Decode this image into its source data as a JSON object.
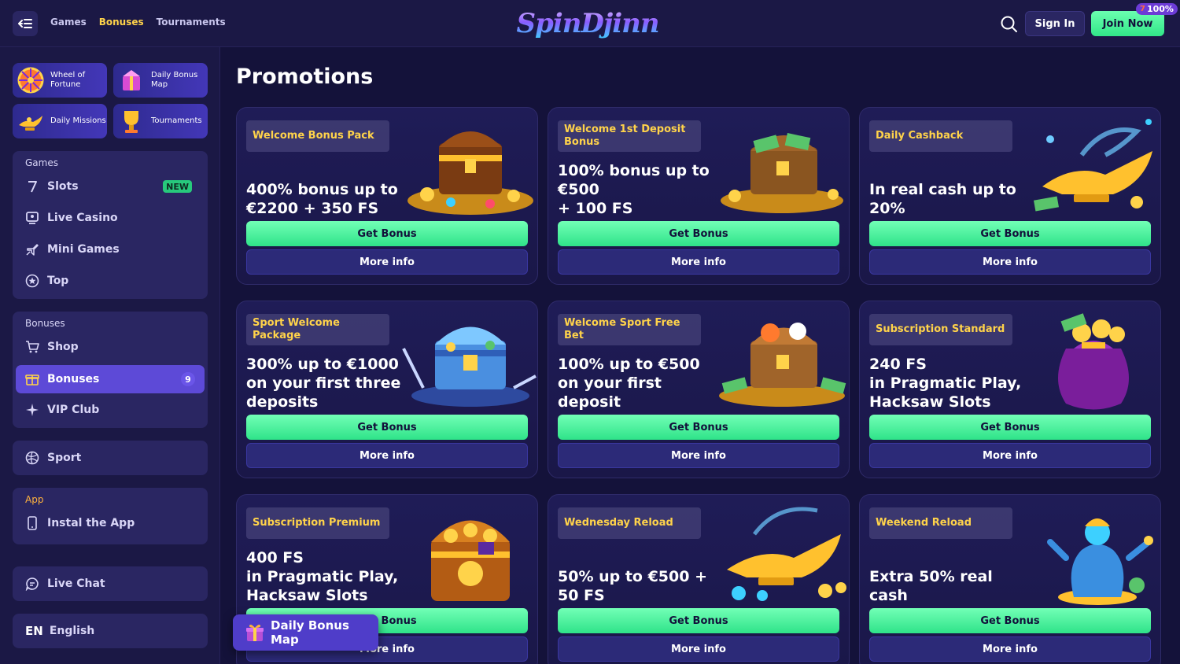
{
  "header": {
    "nav": [
      "Games",
      "Bonuses",
      "Tournaments"
    ],
    "active_nav": "Bonuses",
    "logo": "SpinDjinn",
    "sign_in": "Sign In",
    "join_now": "Join Now",
    "join_badge": "100%"
  },
  "sidebar": {
    "tiles": [
      {
        "label": "Wheel of\nFortune",
        "icon": "wheel-icon"
      },
      {
        "label": "Daily Bonus\nMap",
        "icon": "map-gift-icon"
      },
      {
        "label": "Daily Missions",
        "icon": "lamp-icon"
      },
      {
        "label": "Tournaments",
        "icon": "trophy-icon"
      }
    ],
    "games_title": "Games",
    "games_items": [
      {
        "label": "Slots",
        "badge": "NEW",
        "icon": "seven-icon"
      },
      {
        "label": "Live Casino",
        "icon": "live-icon"
      },
      {
        "label": "Mini Games",
        "icon": "plane-icon"
      },
      {
        "label": "Top",
        "icon": "star-icon"
      }
    ],
    "bonuses_title": "Bonuses",
    "bonuses_items": [
      {
        "label": "Shop",
        "icon": "cart-icon"
      },
      {
        "label": "Bonuses",
        "badge": "9",
        "icon": "gift-icon"
      },
      {
        "label": "VIP Club",
        "icon": "sparkle-icon"
      }
    ],
    "sport": "Sport",
    "app_title": "App",
    "install_app": "Instal the App",
    "live_chat": "Live Chat",
    "lang_code": "EN",
    "lang_name": "English"
  },
  "main": {
    "title": "Promotions",
    "get_bonus": "Get Bonus",
    "more_info": "More info",
    "cards": [
      {
        "label": "Welcome Bonus Pack",
        "desc": "400% bonus up to\n€2200 + 350 FS",
        "art": "treasure-chest"
      },
      {
        "label": "Welcome 1st Deposit Bonus",
        "desc": "100% bonus up to\n€500\n+ 100 FS",
        "art": "money-chest"
      },
      {
        "label": "Daily Cashback",
        "desc": "In real cash up to\n20%",
        "art": "magic-lamp"
      },
      {
        "label": "Sport Welcome Package",
        "desc": "300% up to €1000\non your first three\ndeposits",
        "art": "ice-chest"
      },
      {
        "label": "Welcome Sport Free Bet",
        "desc": "100% up to €500\non your first\ndeposit",
        "art": "sports-chest"
      },
      {
        "label": "Subscription Standard",
        "desc": "240 FS\nin Pragmatic Play,\nHacksaw Slots",
        "art": "coin-bag"
      },
      {
        "label": "Subscription Premium",
        "desc": "400 FS\nin Pragmatic Play,\nHacksaw Slots",
        "art": "gold-chest"
      },
      {
        "label": "Wednesday Reload",
        "desc": "50% up to €500 +\n50 FS",
        "art": "lamp-gems"
      },
      {
        "label": "Weekend Reload",
        "desc": "Extra 50% real\ncash",
        "art": "genie"
      }
    ]
  },
  "float": {
    "label": "Daily Bonus Map"
  },
  "colors": {
    "accent_green": "#31e688",
    "accent_yellow": "#ffd34a",
    "bg": "#14123a",
    "panel": "#2a2662"
  }
}
